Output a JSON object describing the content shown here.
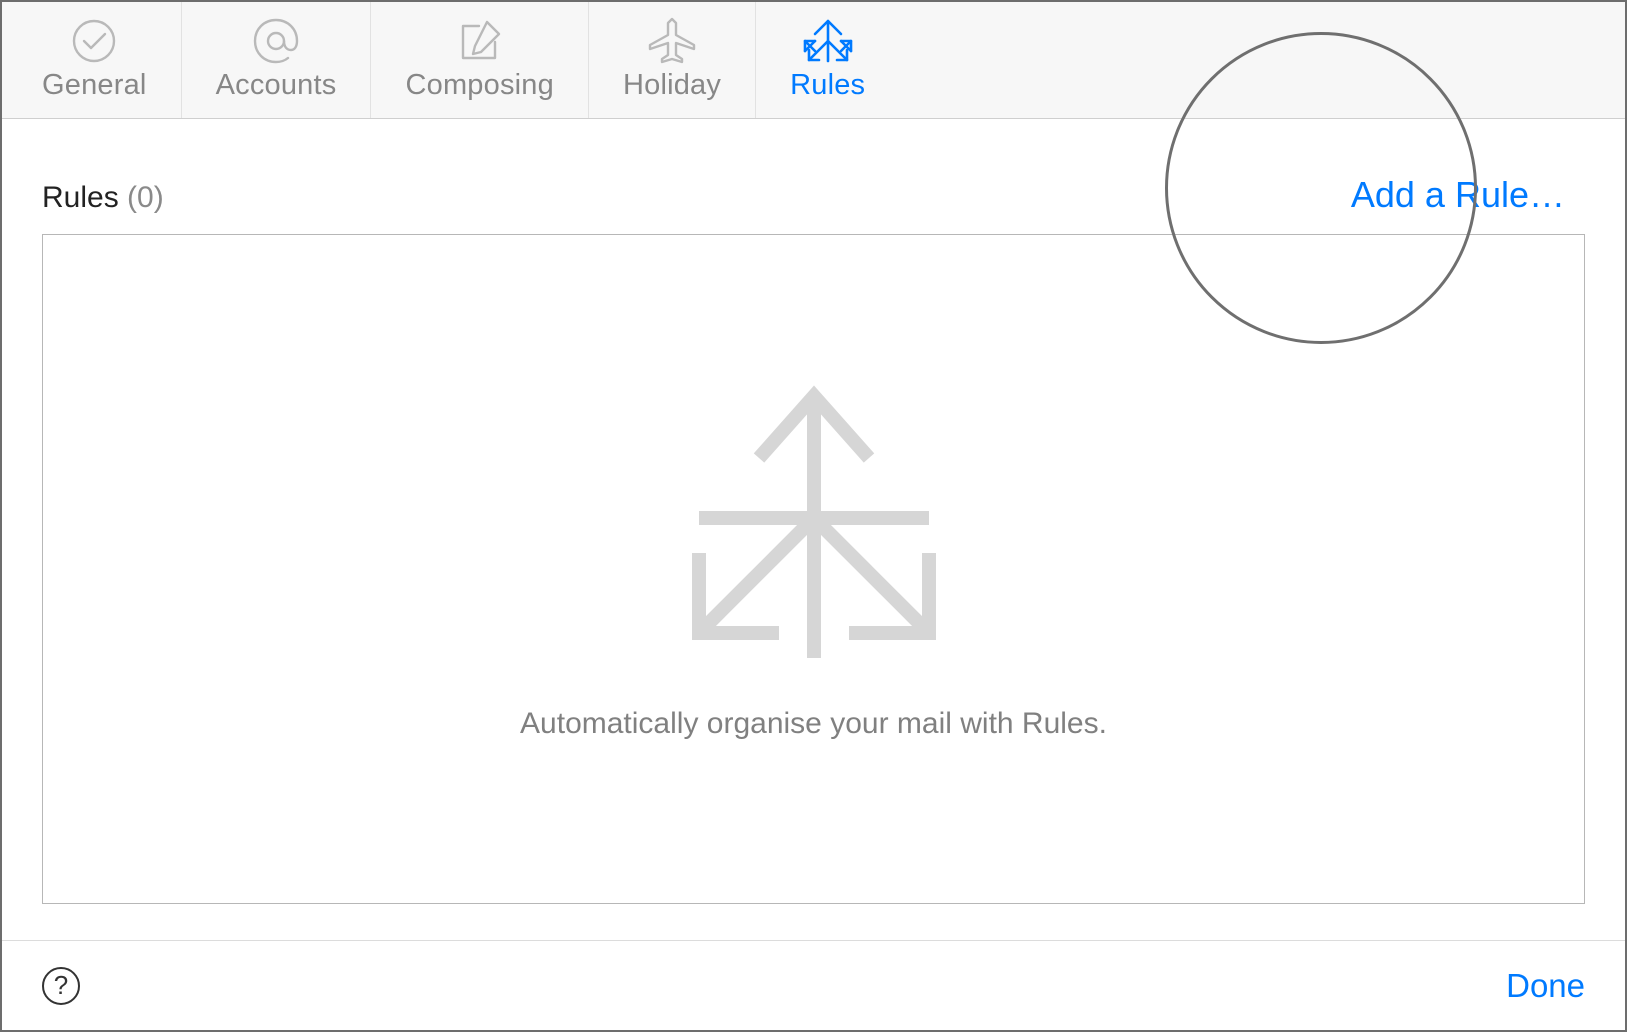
{
  "toolbar": {
    "tabs": [
      {
        "label": "General",
        "icon": "checkmark-circle-icon",
        "active": false
      },
      {
        "label": "Accounts",
        "icon": "at-icon",
        "active": false
      },
      {
        "label": "Composing",
        "icon": "compose-icon",
        "active": false
      },
      {
        "label": "Holiday",
        "icon": "airplane-icon",
        "active": false
      },
      {
        "label": "Rules",
        "icon": "arrows-icon",
        "active": true
      }
    ]
  },
  "main": {
    "heading_label": "Rules",
    "heading_count": "(0)",
    "add_rule_label": "Add a Rule…",
    "empty_icon": "arrows-large-icon",
    "empty_text": "Automatically organise your mail with Rules."
  },
  "footer": {
    "help_label": "?",
    "done_label": "Done"
  },
  "colors": {
    "accent": "#007aff",
    "muted": "#878787",
    "border": "#b7b7b7"
  }
}
